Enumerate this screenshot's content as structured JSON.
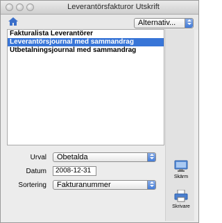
{
  "window": {
    "title": "Leverantörsfakturor Utskrift"
  },
  "toolbar": {
    "options_value": "Alternativ..."
  },
  "reports": [
    {
      "label": "Fakturalista Leverantörer",
      "selected": false
    },
    {
      "label": "Leverantörsjournal med sammandrag",
      "selected": true
    },
    {
      "label": "Utbetalningsjournal med sammandrag",
      "selected": false
    }
  ],
  "form": {
    "urval_label": "Urval",
    "urval_value": "Obetalda",
    "datum_label": "Datum",
    "datum_value": "2008-12-31",
    "sortering_label": "Sortering",
    "sortering_value": "Fakturanummer"
  },
  "actions": {
    "screen_label": "Skärm",
    "printer_label": "Skrivare"
  },
  "colors": {
    "selection": "#3875d7",
    "popup_arrows": "#3f79d8"
  }
}
